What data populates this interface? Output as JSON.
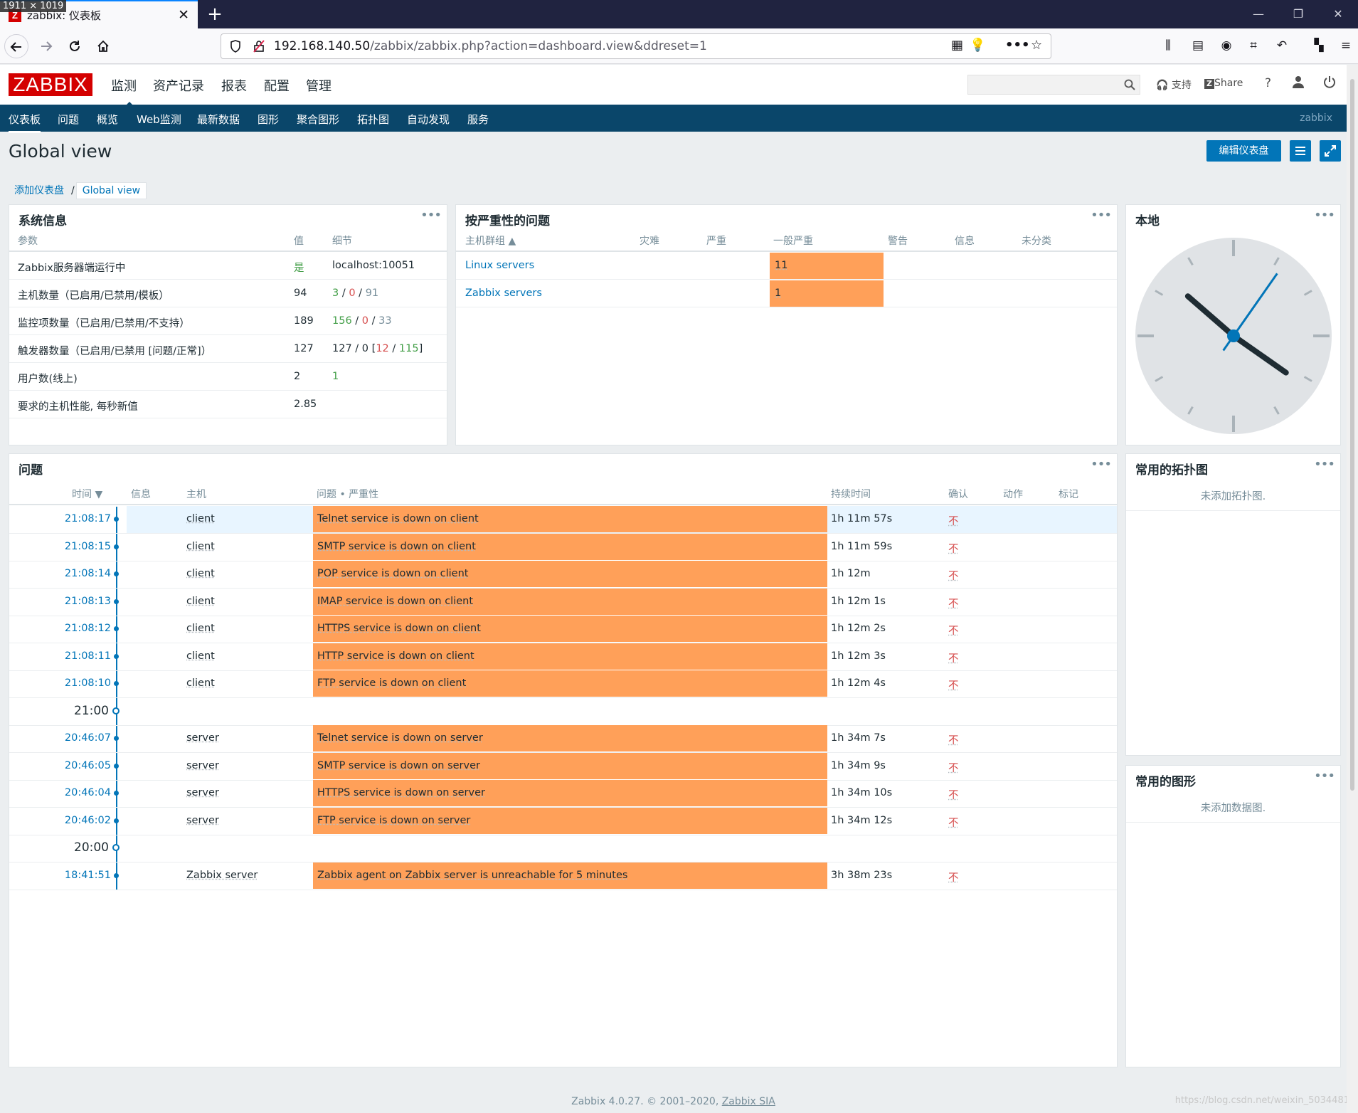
{
  "browser": {
    "tab_title": "zabbix: 仪表板",
    "dim_label": "1911 × 1019",
    "url_host": "192.168.140.50",
    "url_path": "/zabbix/zabbix.php?action=dashboard.view&ddreset=1"
  },
  "header": {
    "logo": "ZABBIX",
    "menu": [
      "监测",
      "资产记录",
      "报表",
      "配置",
      "管理"
    ],
    "support": "支持",
    "share": "Share",
    "help": "?"
  },
  "submenu": {
    "items": [
      "仪表板",
      "问题",
      "概览",
      "Web监测",
      "最新数据",
      "图形",
      "聚合图形",
      "拓扑图",
      "自动发现",
      "服务"
    ],
    "user": "zabbix"
  },
  "page": {
    "title": "Global view",
    "edit_button": "编辑仪表盘",
    "breadcrumb": [
      "添加仪表盘",
      "Global view"
    ]
  },
  "sysinfo": {
    "title": "系统信息",
    "headers": [
      "参数",
      "值",
      "细节"
    ],
    "rows": [
      {
        "param": "Zabbix服务器端运行中",
        "value": "是"
      },
      {
        "param": "主机数量（已启用/已禁用/模板）",
        "value": "94"
      },
      {
        "param": "监控项数量（已启用/已禁用/不支持）",
        "value": "189"
      },
      {
        "param": "触发器数量（已启用/已禁用 [问题/正常]）",
        "value": "127"
      },
      {
        "param": "用户数(线上)",
        "value": "2"
      },
      {
        "param": "要求的主机性能, 每秒新值",
        "value": "2.85"
      }
    ],
    "detail_server": "localhost:10051",
    "hosts_detail": [
      "3",
      "0",
      "91"
    ],
    "items_detail": [
      "156",
      "0",
      "33"
    ],
    "triggers_detail": [
      "127",
      "0",
      "12",
      "115"
    ],
    "users_online": "1"
  },
  "severity": {
    "title": "按严重性的问题",
    "headers": [
      "主机群组 ▲",
      "灾难",
      "严重",
      "一般严重",
      "警告",
      "信息",
      "未分类"
    ],
    "rows": [
      {
        "group": "Linux servers",
        "average": "11"
      },
      {
        "group": "Zabbix servers",
        "average": "1"
      }
    ]
  },
  "clock": {
    "title": "本地",
    "hour_hand_deg": 125,
    "minute_hand_deg": 35
  },
  "problems": {
    "title": "问题",
    "headers": [
      "时间 ▼",
      "信息",
      "主机",
      "问题 • 严重性",
      "持续时间",
      "确认",
      "动作",
      "标记"
    ],
    "rows": [
      {
        "time": "21:08:17",
        "host": "client",
        "problem": "Telnet service is down on client",
        "duration": "1h 11m 57s",
        "ack": "不"
      },
      {
        "time": "21:08:15",
        "host": "client",
        "problem": "SMTP service is down on client",
        "duration": "1h 11m 59s",
        "ack": "不"
      },
      {
        "time": "21:08:14",
        "host": "client",
        "problem": "POP service is down on client",
        "duration": "1h 12m",
        "ack": "不"
      },
      {
        "time": "21:08:13",
        "host": "client",
        "problem": "IMAP service is down on client",
        "duration": "1h 12m 1s",
        "ack": "不"
      },
      {
        "time": "21:08:12",
        "host": "client",
        "problem": "HTTPS service is down on client",
        "duration": "1h 12m 2s",
        "ack": "不"
      },
      {
        "time": "21:08:11",
        "host": "client",
        "problem": "HTTP service is down on client",
        "duration": "1h 12m 3s",
        "ack": "不"
      },
      {
        "time": "21:08:10",
        "host": "client",
        "problem": "FTP service is down on client",
        "duration": "1h 12m 4s",
        "ack": "不"
      },
      {
        "time": "20:46:07",
        "host": "server",
        "problem": "Telnet service is down on server",
        "duration": "1h 34m 7s",
        "ack": "不"
      },
      {
        "time": "20:46:05",
        "host": "server",
        "problem": "SMTP service is down on server",
        "duration": "1h 34m 9s",
        "ack": "不"
      },
      {
        "time": "20:46:04",
        "host": "server",
        "problem": "HTTPS service is down on server",
        "duration": "1h 34m 10s",
        "ack": "不"
      },
      {
        "time": "20:46:02",
        "host": "server",
        "problem": "FTP service is down on server",
        "duration": "1h 34m 12s",
        "ack": "不"
      },
      {
        "time": "18:41:51",
        "host": "Zabbix server",
        "problem": "Zabbix agent on Zabbix server is unreachable for 5 minutes",
        "duration": "3h 38m 23s",
        "ack": "不"
      }
    ],
    "markers": [
      "21:00",
      "20:00"
    ]
  },
  "maps": {
    "title": "常用的拓扑图",
    "empty": "未添加拓扑图."
  },
  "graphs": {
    "title": "常用的图形",
    "empty": "未添加数据图."
  },
  "footer": {
    "text": "Zabbix 4.0.27. © 2001–2020,",
    "link": "Zabbix SIA"
  },
  "watermark": "https://blog.csdn.net/weixin_5034481",
  "colors": {
    "brand_red": "#d40000",
    "nav_blue": "#0a466a",
    "accent": "#0275b8",
    "average_severity": "#ffa059",
    "ok_green": "#429e47",
    "problem_red": "#d64e4e"
  }
}
